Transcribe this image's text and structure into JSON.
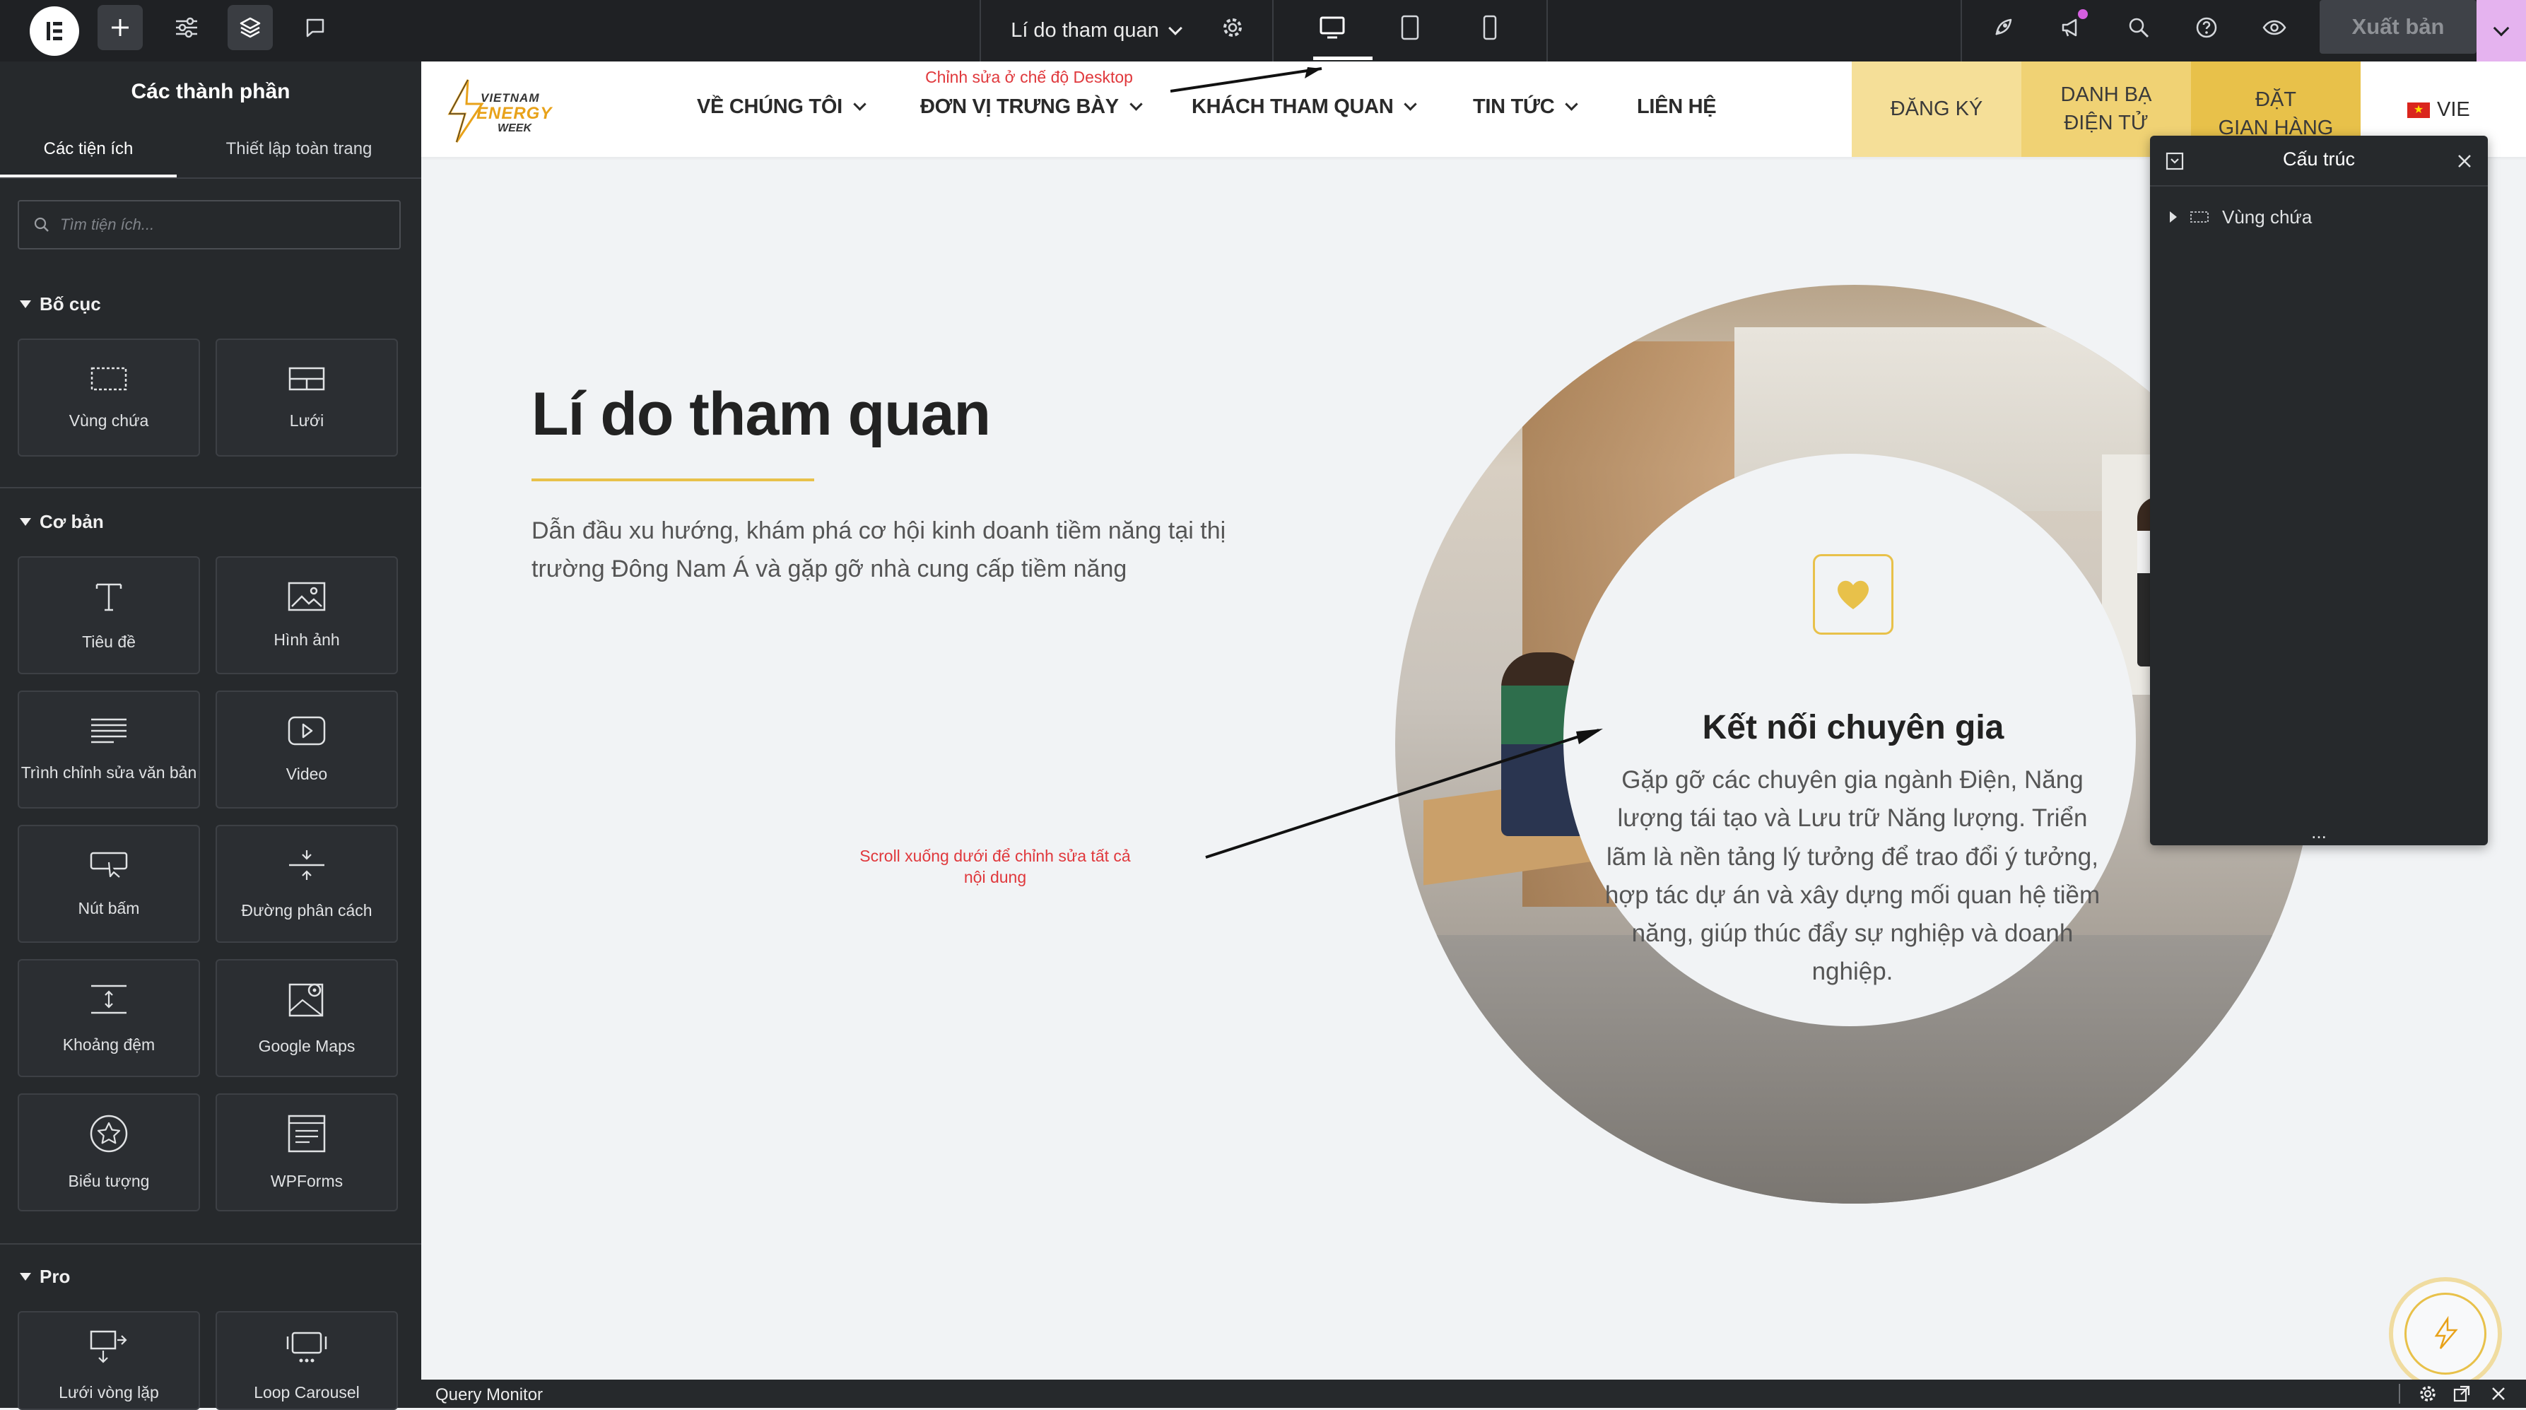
{
  "topbar": {
    "page_name": "Lí do tham quan",
    "publish_label": "Xuất bản"
  },
  "panel": {
    "title": "Các thành phần",
    "tabs": [
      "Các tiện ích",
      "Thiết lập toàn trang"
    ],
    "search_placeholder": "Tìm tiện ích...",
    "sections": {
      "layout": {
        "title": "Bố cục",
        "items": [
          "Vùng chứa",
          "Lưới"
        ]
      },
      "basic": {
        "title": "Cơ bản",
        "items": [
          "Tiêu đề",
          "Hình ảnh",
          "Trình chỉnh sửa văn bản",
          "Video",
          "Nút bấm",
          "Đường phân cách",
          "Khoảng đệm",
          "Google Maps",
          "Biểu tượng",
          "WPForms"
        ]
      },
      "pro": {
        "title": "Pro",
        "items": [
          "Lưới vòng lặp",
          "Loop Carousel"
        ]
      }
    }
  },
  "site": {
    "logo": {
      "line1": "VIETNAM",
      "line2": "ENERGY",
      "line3": "WEEK"
    },
    "nav": [
      "VỀ CHÚNG TÔI",
      "ĐƠN VỊ TRƯNG BÀY",
      "KHÁCH THAM QUAN",
      "TIN TỨC",
      "LIÊN HỆ"
    ],
    "cta": {
      "register": "ĐĂNG KÝ",
      "directory": [
        "DANH BẠ",
        "ĐIỆN TỬ"
      ],
      "booth": [
        "ĐẶT",
        "GIAN HÀNG"
      ]
    },
    "language": "VIE",
    "headline": "Lí do tham quan",
    "intro": "Dẫn đầu xu hướng, khám phá cơ hội kinh doanh tiềm năng tại thị trường Đông Nam Á và gặp gỡ nhà cung cấp tiềm năng",
    "card": {
      "title": "Kết nối chuyên gia",
      "body": "Gặp gỡ các chuyên gia ngành Điện, Năng lượng tái tạo và Lưu trữ Năng lượng. Triển lãm là nền tảng lý tưởng để trao đổi ý tưởng, hợp tác dự án và xây dựng mối quan hệ tiềm năng, giúp thúc đẩy sự nghiệp và doanh nghiệp."
    }
  },
  "annotations": {
    "desktop_note": "Chỉnh sửa ở chế độ Desktop",
    "scroll_note_1": "Scroll xuống dưới để chỉnh sửa tất cả",
    "scroll_note_2": "nội dung"
  },
  "structure": {
    "title": "Cấu trúc",
    "item": "Vùng chứa",
    "more": "..."
  },
  "query_monitor": {
    "label": "Query Monitor"
  },
  "colors": {
    "accent_yellow": "#e8c14a",
    "cta_light": "#f5df98",
    "cta_mid": "#f0d274",
    "editor_dark": "#1f2124",
    "panel_dark": "#26292c",
    "annotation_red": "#e0383c"
  }
}
